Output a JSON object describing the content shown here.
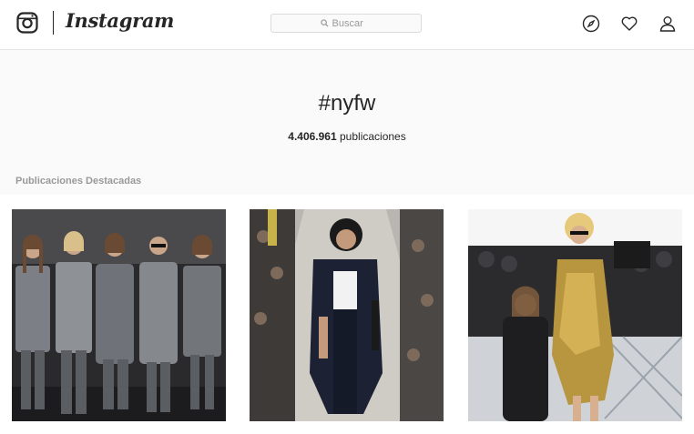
{
  "nav": {
    "brand": "Instagram",
    "search_placeholder": "Buscar",
    "icons": [
      "instagram-glyph-icon",
      "search-icon",
      "compass-icon",
      "heart-icon",
      "user-icon"
    ]
  },
  "hashtag": {
    "title": "#nyfw",
    "posts_count": "4.406.961",
    "posts_unit": "publicaciones"
  },
  "top_posts_label": "Publicaciones Destacadas",
  "colors": {
    "text": "#262626",
    "muted": "#999999",
    "border": "#dbdbdb",
    "background": "#fafafa"
  }
}
